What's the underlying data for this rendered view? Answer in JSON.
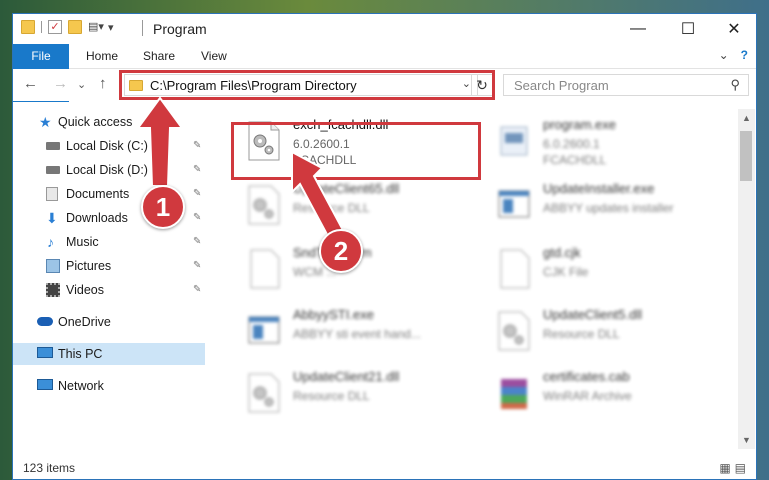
{
  "window": {
    "title": "Program",
    "controls": {
      "minimize": "—",
      "maximize": "☐",
      "close": "✕"
    }
  },
  "ribbon": {
    "tabs": [
      "File",
      "Home",
      "Share",
      "View"
    ],
    "expand_glyph": "⌄",
    "help_glyph": "?"
  },
  "nav": {
    "back": "←",
    "forward": "→",
    "recent": "⌄",
    "up": "↑",
    "address": "C:\\Program Files\\Program Directory",
    "address_dropdown": "⌄",
    "refresh": "↻",
    "search_placeholder": "Search Program",
    "search_icon": "search-icon"
  },
  "sidebar": {
    "items": [
      {
        "label": "Quick access",
        "icon": "star-icon"
      },
      {
        "label": "Local Disk (C:)",
        "icon": "drive-icon",
        "pinned": true
      },
      {
        "label": "Local Disk (D:)",
        "icon": "drive-icon",
        "pinned": true
      },
      {
        "label": "Documents",
        "icon": "documents-icon",
        "pinned": true
      },
      {
        "label": "Downloads",
        "icon": "download-icon",
        "pinned": true
      },
      {
        "label": "Music",
        "icon": "music-icon",
        "pinned": true
      },
      {
        "label": "Pictures",
        "icon": "pictures-icon",
        "pinned": true
      },
      {
        "label": "Videos",
        "icon": "videos-icon",
        "pinned": true
      },
      {
        "label": "OneDrive",
        "icon": "cloud-icon"
      },
      {
        "label": "This PC",
        "icon": "computer-icon",
        "selected": true
      },
      {
        "label": "Network",
        "icon": "network-icon"
      }
    ],
    "pin_glyph": "📌"
  },
  "files": [
    {
      "name": "exch_fcachdll.dll",
      "line1": "6.0.2600.1",
      "line2": "FCACHDLL",
      "icon": "dll-gear-icon",
      "highlight": true
    },
    {
      "name": "program.exe",
      "line1": "6.0.2600.1",
      "line2": "FCACHDLL",
      "icon": "exe-icon"
    },
    {
      "name": "UpdateClient65.dll",
      "line1": "Resource DLL",
      "line2": "",
      "icon": "dll-gear-icon"
    },
    {
      "name": "UpdateInstaller.exe",
      "line1": "ABBYY updates installer",
      "line2": "",
      "icon": "exe-window-icon"
    },
    {
      "name": "SndTo...axcm",
      "line1": "WCM ...",
      "line2": "",
      "icon": "file-icon"
    },
    {
      "name": "gtd.cjk",
      "line1": "CJK File",
      "line2": "",
      "icon": "file-icon"
    },
    {
      "name": "AbbyySTI.exe",
      "line1": "ABBYY sti event hand...",
      "line2": "",
      "icon": "exe-window-icon"
    },
    {
      "name": "UpdateClient5.dll",
      "line1": "Resource DLL",
      "line2": "",
      "icon": "dll-gear-icon"
    },
    {
      "name": "UpdateClient21.dll",
      "line1": "Resource DLL",
      "line2": "",
      "icon": "dll-gear-icon"
    },
    {
      "name": "certificates.cab",
      "line1": "WinRAR Archive",
      "line2": "",
      "icon": "archive-icon"
    }
  ],
  "status": {
    "count": "123 items"
  },
  "callouts": [
    "1",
    "2"
  ],
  "colors": {
    "accent": "#1979ca",
    "highlight_red": "#d0393e",
    "selected": "#cce4f7"
  }
}
